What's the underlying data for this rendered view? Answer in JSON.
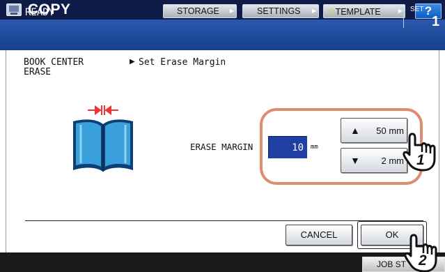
{
  "header": {
    "app_title": "COPY",
    "app_icon": "copy-icon",
    "buttons": {
      "storage": "STORAGE",
      "settings": "SETTINGS",
      "template": "TEMPLATE",
      "help": "?"
    }
  },
  "status": {
    "text": "READY",
    "set_label": "SET",
    "set_count": "1"
  },
  "breadcrumb": {
    "line1": "BOOK CENTER",
    "line2": "ERASE",
    "separator": "▶",
    "current": "Set Erase Margin"
  },
  "form": {
    "label": "ERASE MARGIN",
    "value": "10",
    "unit": "mm",
    "up_button": "50 mm",
    "down_button": "2 mm"
  },
  "actions": {
    "cancel": "CANCEL",
    "ok": "OK"
  },
  "footer": {
    "job_status": "JOB ST"
  },
  "markers": {
    "step1": "1",
    "step2": "2"
  },
  "colors": {
    "title_bar": "#0e1c47",
    "status_bar": "#2357b0",
    "value_field": "#1f3fa2",
    "highlight_ring": "#e08c73",
    "book_blue": "#3aa0dc",
    "margin_arrows": "#e8363a"
  }
}
